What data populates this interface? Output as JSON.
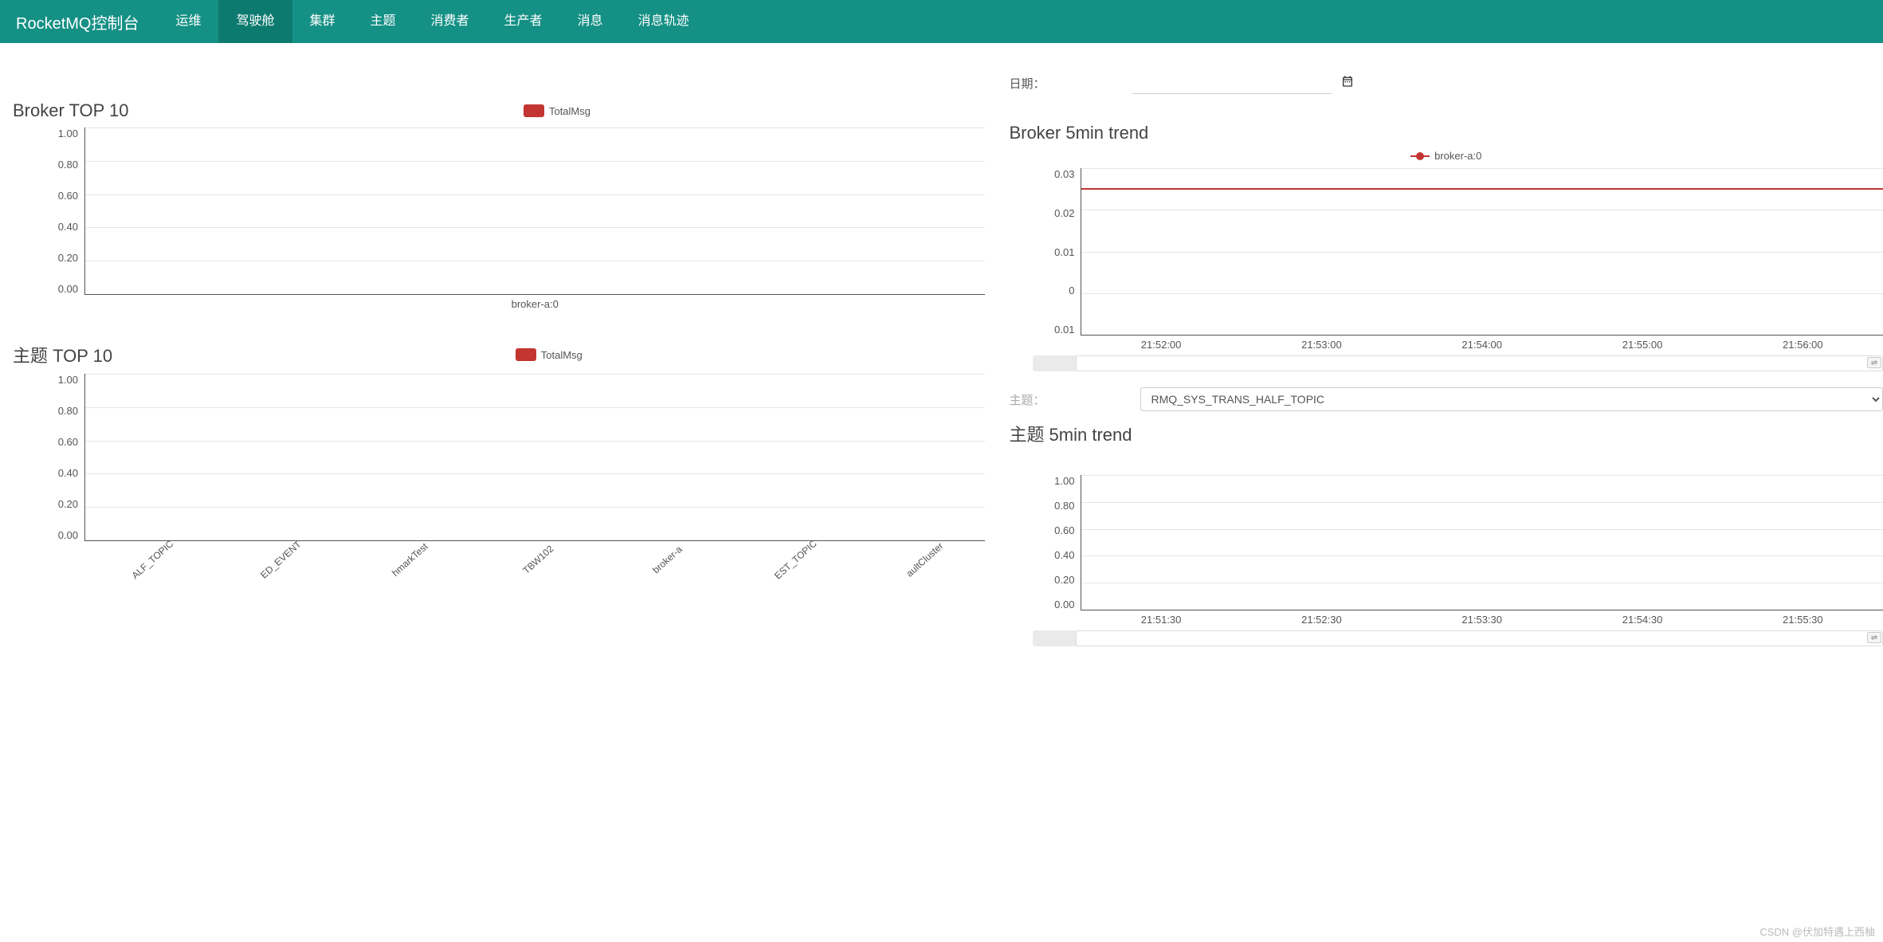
{
  "navbar": {
    "brand": "RocketMQ控制台",
    "items": [
      {
        "label": "运维"
      },
      {
        "label": "驾驶舱",
        "active": true
      },
      {
        "label": "集群"
      },
      {
        "label": "主题"
      },
      {
        "label": "消费者"
      },
      {
        "label": "生产者"
      },
      {
        "label": "消息"
      },
      {
        "label": "消息轨迹"
      }
    ]
  },
  "date": {
    "label": "日期：",
    "value": ""
  },
  "topic_select": {
    "label": "主题：",
    "value": "RMQ_SYS_TRANS_HALF_TOPIC"
  },
  "chart_data": [
    {
      "id": "broker_top10",
      "title": "Broker TOP 10",
      "type": "bar",
      "legend": "TotalMsg",
      "legend_color": "#c23531",
      "y_ticks": [
        "1.00",
        "0.80",
        "0.60",
        "0.40",
        "0.20",
        "0.00"
      ],
      "ylim": [
        0,
        1
      ],
      "categories": [
        "broker-a:0"
      ],
      "values": [
        0
      ]
    },
    {
      "id": "topic_top10",
      "title": "主题 TOP 10",
      "type": "bar",
      "legend": "TotalMsg",
      "legend_color": "#c23531",
      "y_ticks": [
        "1.00",
        "0.80",
        "0.60",
        "0.40",
        "0.20",
        "0.00"
      ],
      "ylim": [
        0,
        1
      ],
      "categories": [
        "ALF_TOPIC",
        "ED_EVENT",
        "hmarkTest",
        "TBW102",
        "broker-a",
        "EST_TOPIC",
        "aultCluster"
      ],
      "values": [
        0,
        0,
        0,
        0,
        0,
        0,
        0
      ]
    },
    {
      "id": "broker_5min_trend",
      "title": "Broker 5min trend",
      "type": "line",
      "legend": "broker-a:0",
      "legend_color": "#c23531",
      "y_ticks": [
        "0.03",
        "0.02",
        "0.01",
        "0",
        "0.01"
      ],
      "ylim": [
        -0.01,
        0.03
      ],
      "x": [
        "21:52:00",
        "21:53:00",
        "21:54:00",
        "21:55:00",
        "21:56:00"
      ],
      "series": [
        {
          "name": "broker-a:0",
          "values": [
            0.025,
            0.025,
            0.025,
            0.025,
            0.025
          ]
        }
      ],
      "line_top_percent": 12
    },
    {
      "id": "topic_5min_trend",
      "title": "主题 5min trend",
      "type": "line",
      "legend": "",
      "y_ticks": [
        "1.00",
        "0.80",
        "0.60",
        "0.40",
        "0.20",
        "0.00"
      ],
      "ylim": [
        0,
        1
      ],
      "x": [
        "21:51:30",
        "21:52:30",
        "21:53:30",
        "21:54:30",
        "21:55:30"
      ],
      "series": [],
      "line_top_percent": null
    }
  ],
  "watermark": "CSDN @伏加特遇上西柚"
}
